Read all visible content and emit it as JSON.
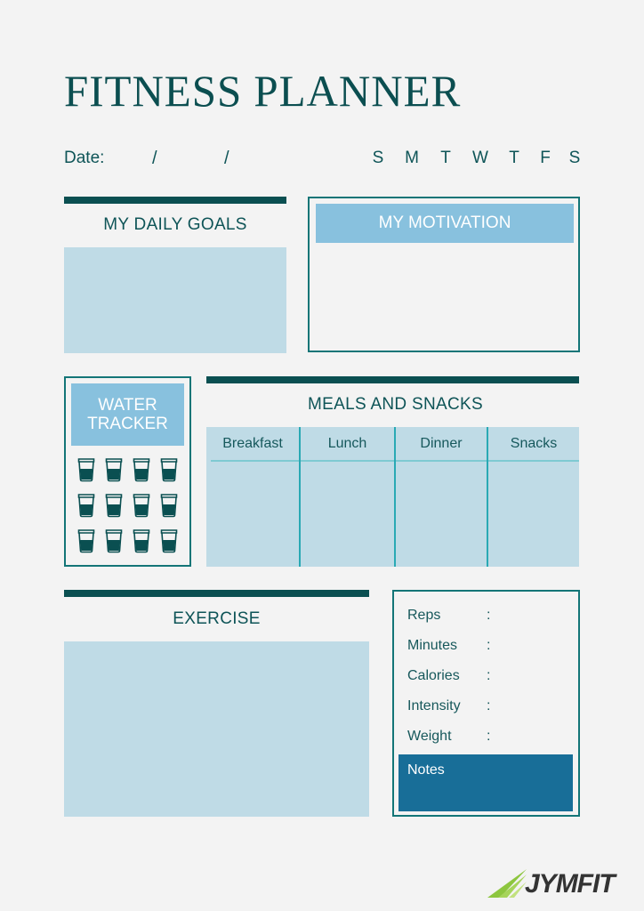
{
  "title": "FITNESS PLANNER",
  "date": {
    "label": "Date:",
    "separator": "/"
  },
  "days": [
    "S",
    "M",
    "T",
    "W",
    "T",
    "F",
    "S"
  ],
  "sections": {
    "daily_goals": "MY DAILY GOALS",
    "motivation": "MY MOTIVATION",
    "water_tracker": {
      "line1": "WATER",
      "line2": "TRACKER",
      "glasses": 12,
      "glass_icon": "water-glass-icon"
    },
    "meals": {
      "title": "MEALS AND SNACKS",
      "columns": [
        "Breakfast",
        "Lunch",
        "Dinner",
        "Snacks"
      ]
    },
    "exercise": "EXERCISE",
    "stats": {
      "rows": [
        {
          "label": "Reps",
          "sep": ":"
        },
        {
          "label": "Minutes",
          "sep": ":"
        },
        {
          "label": "Calories",
          "sep": ":"
        },
        {
          "label": "Intensity",
          "sep": ":"
        },
        {
          "label": "Weight",
          "sep": ":"
        }
      ],
      "notes": "Notes"
    }
  },
  "brand": {
    "name": "JYMFIT",
    "accent": "#8dc63f"
  },
  "colors": {
    "dark_teal": "#0a4f51",
    "light_blue_panel": "#bfdbe6",
    "header_blue": "#88c1de",
    "notes_blue": "#186e98",
    "background": "#f3f3f3"
  }
}
